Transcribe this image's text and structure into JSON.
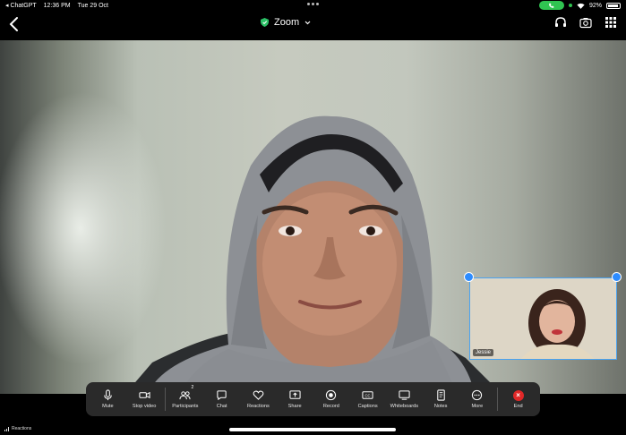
{
  "status_bar": {
    "back_app": "◂ ChatGPT",
    "time": "12:36 PM",
    "date": "Tue 29 Oct",
    "battery": "92%"
  },
  "meeting": {
    "title": "Zoom"
  },
  "self_view": {
    "name": "Jessie"
  },
  "toolbar": {
    "participants_count": "2",
    "buttons": [
      {
        "label": "Mute",
        "icon": "microphone-icon"
      },
      {
        "label": "Stop video",
        "icon": "video-camera-icon"
      },
      {
        "label": "Participants",
        "icon": "participants-icon"
      },
      {
        "label": "Chat",
        "icon": "chat-bubble-icon"
      },
      {
        "label": "Reactions",
        "icon": "heart-icon"
      },
      {
        "label": "Share",
        "icon": "share-screen-icon"
      },
      {
        "label": "Record",
        "icon": "record-icon"
      },
      {
        "label": "Captions",
        "icon": "captions-icon"
      },
      {
        "label": "Whiteboards",
        "icon": "whiteboard-icon"
      },
      {
        "label": "Notes",
        "icon": "notes-icon"
      },
      {
        "label": "More",
        "icon": "more-icon"
      },
      {
        "label": "End",
        "icon": "end-call-icon"
      }
    ]
  },
  "bottom_bar": {
    "label": "Reactions"
  },
  "colors": {
    "accent": "#2d8cff",
    "end": "#e02828",
    "status_green": "#30c451",
    "toolbar_bg": "#2a2a2a"
  }
}
